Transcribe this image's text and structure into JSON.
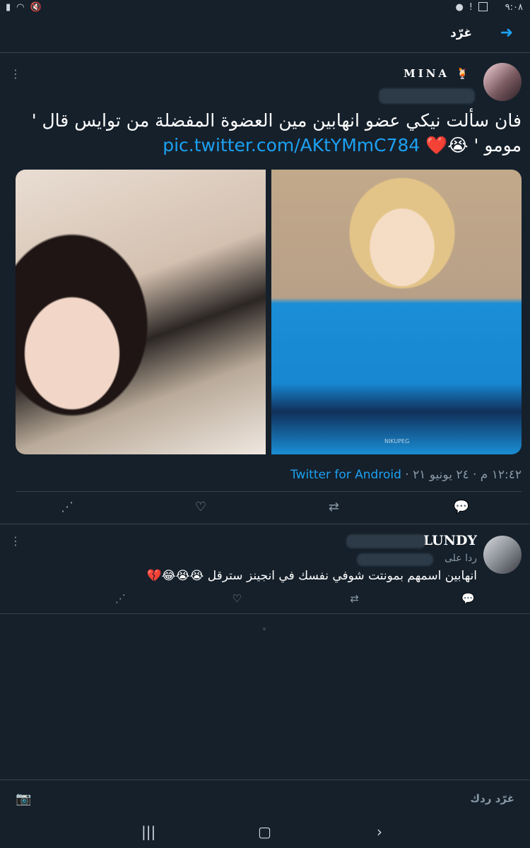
{
  "statusbar": {
    "time": "٩:٠٨"
  },
  "header": {
    "title": "غرّد"
  },
  "tweet": {
    "display_name": "MINA",
    "emoji": "🍹",
    "text": "فان سألت نيكي عضو انهابين مين العضوة المفضلة من توايس قال ' مومو ' ",
    "text_emoji": "😭❤️",
    "link": "pic.twitter.com/AKtYMmC784",
    "photo_left_label": "",
    "photo_right_watermark": "NIKUPEG",
    "meta_time": "١٢:٤٢ م · ٢٤ يونيو ٢١ ·",
    "meta_source": "Twitter for Android"
  },
  "reply": {
    "display_name": "LUNDY",
    "replying_to": "ردا على",
    "text": "انهابين اسمهم بمونتت شوفي نفسك في انجينز سترقل ",
    "emoji": "😭😭😂💔"
  },
  "composer": {
    "placeholder": "غرّد ردك"
  },
  "icons": {
    "back": "arrow-right-icon",
    "reply": "comment-icon",
    "retweet": "retweet-icon",
    "like": "heart-icon",
    "share": "share-icon",
    "camera": "camera-icon",
    "more": "more-vertical-icon"
  },
  "colors": {
    "background": "#15202b",
    "accent": "#1da1f2",
    "divider": "#38444d",
    "muted": "#8899a6"
  }
}
